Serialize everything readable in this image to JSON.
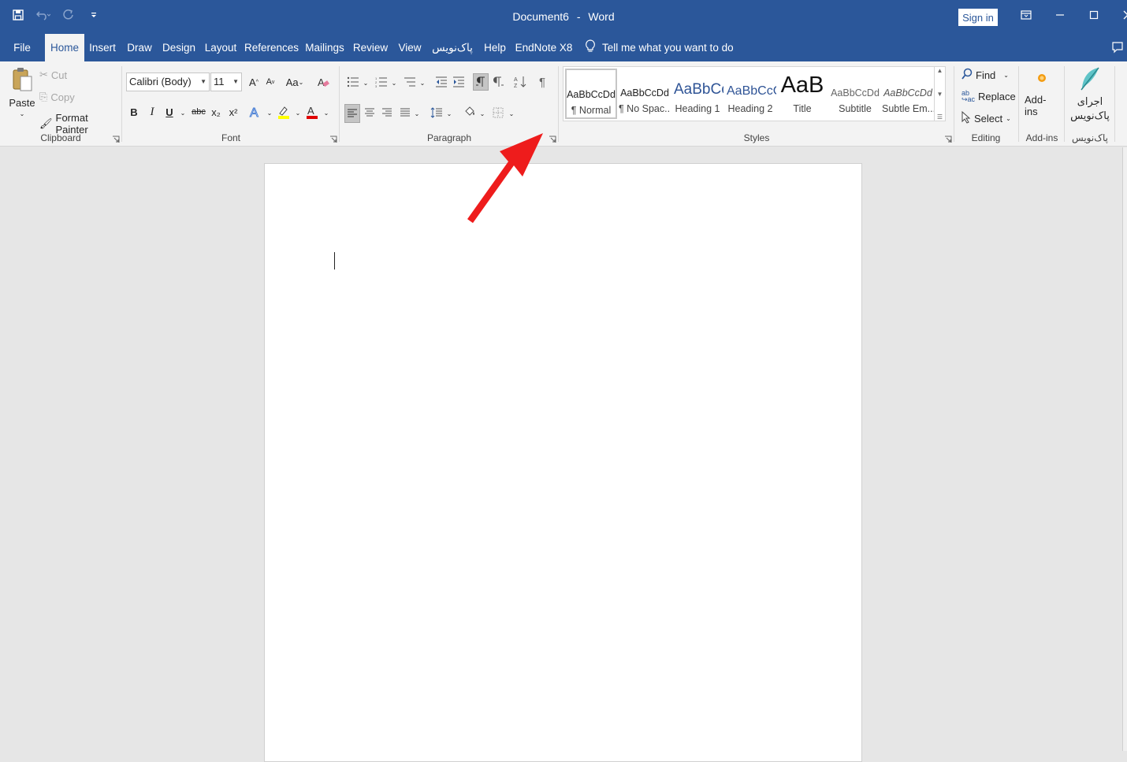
{
  "window": {
    "document_name": "Document6",
    "separator": "-",
    "app_name": "Word",
    "sign_in": "Sign in"
  },
  "tabs": [
    "File",
    "Home",
    "Insert",
    "Draw",
    "Design",
    "Layout",
    "References",
    "Mailings",
    "Review",
    "View",
    "پاک‌نویس",
    "Help",
    "EndNote X8"
  ],
  "active_tab": "Home",
  "tell_me": "Tell me what you want to do",
  "clipboard": {
    "paste": "Paste",
    "cut": "Cut",
    "copy": "Copy",
    "format_painter": "Format Painter",
    "label": "Clipboard"
  },
  "font": {
    "name": "Calibri (Body)",
    "size": "11",
    "bold": "B",
    "italic": "I",
    "underline": "U",
    "strike": "abc",
    "subscript": "x₂",
    "superscript": "x²",
    "change_case": "Aa",
    "label": "Font"
  },
  "paragraph": {
    "label": "Paragraph",
    "pilcrow": "¶"
  },
  "styles": {
    "label": "Styles",
    "items": [
      {
        "sample": "AaBbCcDd",
        "name": "¶ Normal"
      },
      {
        "sample": "AaBbCcDd",
        "name": "¶ No Spac..."
      },
      {
        "sample": "AaBbCc",
        "name": "Heading 1"
      },
      {
        "sample": "AaBbCcC",
        "name": "Heading 2"
      },
      {
        "sample": "AaB",
        "name": "Title"
      },
      {
        "sample": "AaBbCcDd",
        "name": "Subtitle"
      },
      {
        "sample": "AaBbCcDd",
        "name": "Subtle Em..."
      }
    ]
  },
  "editing": {
    "find": "Find",
    "replace": "Replace",
    "select": "Select",
    "label": "Editing"
  },
  "addins": {
    "button": "Add-ins",
    "label": "Add-ins"
  },
  "paknevis": {
    "button_line1": "اجرای",
    "button_line2": "پاک‌نویس",
    "label": "پاک‌نویس"
  },
  "colors": {
    "titlebar": "#2b579a",
    "arrow": "#ee1c1c",
    "heading": "#2f5496"
  }
}
